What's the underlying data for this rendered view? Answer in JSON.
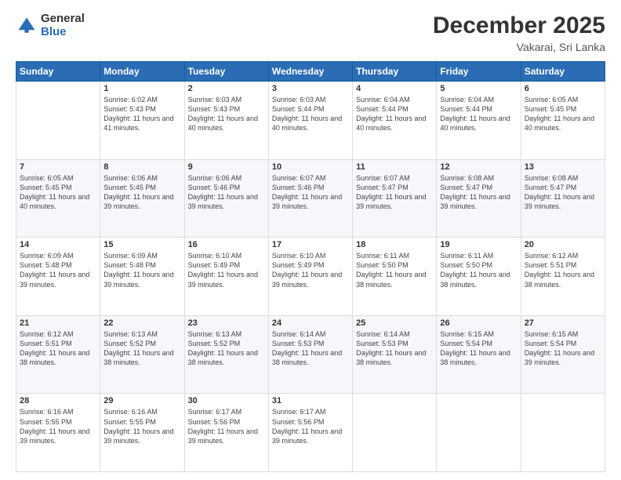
{
  "header": {
    "logo_general": "General",
    "logo_blue": "Blue",
    "title": "December 2025",
    "subtitle": "Vakarai, Sri Lanka"
  },
  "calendar": {
    "weekdays": [
      "Sunday",
      "Monday",
      "Tuesday",
      "Wednesday",
      "Thursday",
      "Friday",
      "Saturday"
    ],
    "weeks": [
      [
        {
          "day": "",
          "sunrise": "",
          "sunset": "",
          "daylight": ""
        },
        {
          "day": "1",
          "sunrise": "Sunrise: 6:02 AM",
          "sunset": "Sunset: 5:43 PM",
          "daylight": "Daylight: 11 hours and 41 minutes."
        },
        {
          "day": "2",
          "sunrise": "Sunrise: 6:03 AM",
          "sunset": "Sunset: 5:43 PM",
          "daylight": "Daylight: 11 hours and 40 minutes."
        },
        {
          "day": "3",
          "sunrise": "Sunrise: 6:03 AM",
          "sunset": "Sunset: 5:44 PM",
          "daylight": "Daylight: 11 hours and 40 minutes."
        },
        {
          "day": "4",
          "sunrise": "Sunrise: 6:04 AM",
          "sunset": "Sunset: 5:44 PM",
          "daylight": "Daylight: 11 hours and 40 minutes."
        },
        {
          "day": "5",
          "sunrise": "Sunrise: 6:04 AM",
          "sunset": "Sunset: 5:44 PM",
          "daylight": "Daylight: 11 hours and 40 minutes."
        },
        {
          "day": "6",
          "sunrise": "Sunrise: 6:05 AM",
          "sunset": "Sunset: 5:45 PM",
          "daylight": "Daylight: 11 hours and 40 minutes."
        }
      ],
      [
        {
          "day": "7",
          "sunrise": "Sunrise: 6:05 AM",
          "sunset": "Sunset: 5:45 PM",
          "daylight": "Daylight: 11 hours and 40 minutes."
        },
        {
          "day": "8",
          "sunrise": "Sunrise: 6:06 AM",
          "sunset": "Sunset: 5:45 PM",
          "daylight": "Daylight: 11 hours and 39 minutes."
        },
        {
          "day": "9",
          "sunrise": "Sunrise: 6:06 AM",
          "sunset": "Sunset: 5:46 PM",
          "daylight": "Daylight: 11 hours and 39 minutes."
        },
        {
          "day": "10",
          "sunrise": "Sunrise: 6:07 AM",
          "sunset": "Sunset: 5:46 PM",
          "daylight": "Daylight: 11 hours and 39 minutes."
        },
        {
          "day": "11",
          "sunrise": "Sunrise: 6:07 AM",
          "sunset": "Sunset: 5:47 PM",
          "daylight": "Daylight: 11 hours and 39 minutes."
        },
        {
          "day": "12",
          "sunrise": "Sunrise: 6:08 AM",
          "sunset": "Sunset: 5:47 PM",
          "daylight": "Daylight: 11 hours and 39 minutes."
        },
        {
          "day": "13",
          "sunrise": "Sunrise: 6:08 AM",
          "sunset": "Sunset: 5:47 PM",
          "daylight": "Daylight: 11 hours and 39 minutes."
        }
      ],
      [
        {
          "day": "14",
          "sunrise": "Sunrise: 6:09 AM",
          "sunset": "Sunset: 5:48 PM",
          "daylight": "Daylight: 11 hours and 39 minutes."
        },
        {
          "day": "15",
          "sunrise": "Sunrise: 6:09 AM",
          "sunset": "Sunset: 5:48 PM",
          "daylight": "Daylight: 11 hours and 39 minutes."
        },
        {
          "day": "16",
          "sunrise": "Sunrise: 6:10 AM",
          "sunset": "Sunset: 5:49 PM",
          "daylight": "Daylight: 11 hours and 39 minutes."
        },
        {
          "day": "17",
          "sunrise": "Sunrise: 6:10 AM",
          "sunset": "Sunset: 5:49 PM",
          "daylight": "Daylight: 11 hours and 39 minutes."
        },
        {
          "day": "18",
          "sunrise": "Sunrise: 6:11 AM",
          "sunset": "Sunset: 5:50 PM",
          "daylight": "Daylight: 11 hours and 38 minutes."
        },
        {
          "day": "19",
          "sunrise": "Sunrise: 6:11 AM",
          "sunset": "Sunset: 5:50 PM",
          "daylight": "Daylight: 11 hours and 38 minutes."
        },
        {
          "day": "20",
          "sunrise": "Sunrise: 6:12 AM",
          "sunset": "Sunset: 5:51 PM",
          "daylight": "Daylight: 11 hours and 38 minutes."
        }
      ],
      [
        {
          "day": "21",
          "sunrise": "Sunrise: 6:12 AM",
          "sunset": "Sunset: 5:51 PM",
          "daylight": "Daylight: 11 hours and 38 minutes."
        },
        {
          "day": "22",
          "sunrise": "Sunrise: 6:13 AM",
          "sunset": "Sunset: 5:52 PM",
          "daylight": "Daylight: 11 hours and 38 minutes."
        },
        {
          "day": "23",
          "sunrise": "Sunrise: 6:13 AM",
          "sunset": "Sunset: 5:52 PM",
          "daylight": "Daylight: 11 hours and 38 minutes."
        },
        {
          "day": "24",
          "sunrise": "Sunrise: 6:14 AM",
          "sunset": "Sunset: 5:53 PM",
          "daylight": "Daylight: 11 hours and 38 minutes."
        },
        {
          "day": "25",
          "sunrise": "Sunrise: 6:14 AM",
          "sunset": "Sunset: 5:53 PM",
          "daylight": "Daylight: 11 hours and 38 minutes."
        },
        {
          "day": "26",
          "sunrise": "Sunrise: 6:15 AM",
          "sunset": "Sunset: 5:54 PM",
          "daylight": "Daylight: 11 hours and 38 minutes."
        },
        {
          "day": "27",
          "sunrise": "Sunrise: 6:15 AM",
          "sunset": "Sunset: 5:54 PM",
          "daylight": "Daylight: 11 hours and 39 minutes."
        }
      ],
      [
        {
          "day": "28",
          "sunrise": "Sunrise: 6:16 AM",
          "sunset": "Sunset: 5:55 PM",
          "daylight": "Daylight: 11 hours and 39 minutes."
        },
        {
          "day": "29",
          "sunrise": "Sunrise: 6:16 AM",
          "sunset": "Sunset: 5:55 PM",
          "daylight": "Daylight: 11 hours and 39 minutes."
        },
        {
          "day": "30",
          "sunrise": "Sunrise: 6:17 AM",
          "sunset": "Sunset: 5:56 PM",
          "daylight": "Daylight: 11 hours and 39 minutes."
        },
        {
          "day": "31",
          "sunrise": "Sunrise: 6:17 AM",
          "sunset": "Sunset: 5:56 PM",
          "daylight": "Daylight: 11 hours and 39 minutes."
        },
        {
          "day": "",
          "sunrise": "",
          "sunset": "",
          "daylight": ""
        },
        {
          "day": "",
          "sunrise": "",
          "sunset": "",
          "daylight": ""
        },
        {
          "day": "",
          "sunrise": "",
          "sunset": "",
          "daylight": ""
        }
      ]
    ]
  }
}
